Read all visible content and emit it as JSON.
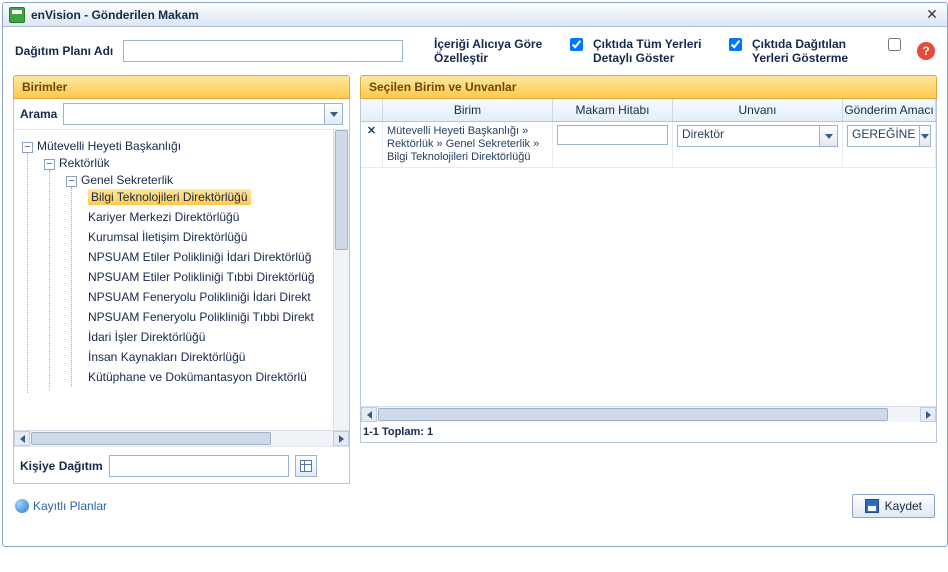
{
  "title": "enVision - Gönderilen Makam",
  "labels": {
    "plan_adi": "Dağıtım Planı Adı",
    "arama": "Arama",
    "kisiye": "Kişiye Dağıtım",
    "kayitli": "Kayıtlı Planlar",
    "kaydet": "Kaydet"
  },
  "options": {
    "opt1": "İçeriği Alıcıya Göre Özelleştir",
    "opt2": "Çıktıda Tüm Yerleri Detaylı Göster",
    "opt3": "Çıktıda Dağıtılan Yerleri Gösterme"
  },
  "panels": {
    "left": "Birimler",
    "right": "Seçilen Birim ve Unvanlar"
  },
  "tree": {
    "n1": "Mütevelli Heyeti Başkanlığı",
    "n2": "Rektörlük",
    "n3": "Genel Sekreterlik",
    "leaves": [
      "Bilgi Teknolojileri Direktörlüğü",
      "Kariyer Merkezi Direktörlüğü",
      "Kurumsal İletişim Direktörlüğü",
      "NPSUAM Etiler Polikliniği İdari Direktörlüğ",
      "NPSUAM Etiler Polikliniği Tıbbi Direktörlüğ",
      "NPSUAM Feneryolu Polikliniği İdari Direkt",
      "NPSUAM Feneryolu Polikliniği Tıbbi Direkt",
      "İdari İşler Direktörlüğü",
      "İnsan Kaynakları Direktörlüğü",
      "Kütüphane ve Dokümantasyon Direktörlü"
    ]
  },
  "grid": {
    "headers": {
      "birim": "Birim",
      "hitap": "Makam Hitabı",
      "unvan": "Unvanı",
      "amac": "Gönderim Amacı"
    },
    "row": {
      "birim": "Mütevelli Heyeti Başkanlığı » Rektörlük » Genel Sekreterlik » Bilgi Teknolojileri Direktörlüğü",
      "hitap": "",
      "unvan": "Direktör",
      "amac": "GEREĞİNE"
    },
    "footer": "1-1 Toplam: 1"
  }
}
